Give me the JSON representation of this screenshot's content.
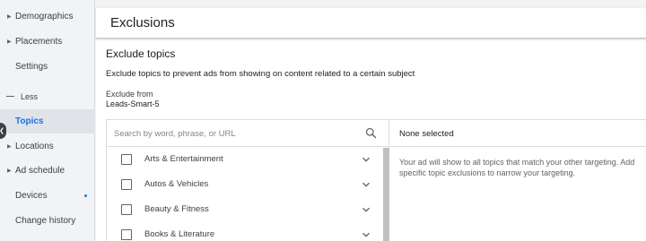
{
  "sidebar": {
    "items": [
      {
        "label": "Demographics",
        "caret": true
      },
      {
        "label": "Placements",
        "caret": true
      },
      {
        "label": "Settings",
        "caret": false
      }
    ],
    "less_label": "Less",
    "items_after": [
      {
        "label": "Topics",
        "caret": false,
        "active": true
      },
      {
        "label": "Locations",
        "caret": true
      },
      {
        "label": "Ad schedule",
        "caret": true
      },
      {
        "label": "Devices",
        "caret": false,
        "dot": true
      },
      {
        "label": "Change history",
        "caret": false
      }
    ]
  },
  "header": {
    "title": "Exclusions"
  },
  "main": {
    "section_title": "Exclude topics",
    "description": "Exclude topics to prevent ads from showing on content related to a certain subject",
    "exclude_from_label": "Exclude from",
    "exclude_from_value": "Leads-Smart-5"
  },
  "picker": {
    "search_placeholder": "Search by word, phrase, or URL",
    "topics": [
      {
        "label": "Arts & Entertainment",
        "checked": false
      },
      {
        "label": "Autos & Vehicles",
        "checked": false
      },
      {
        "label": "Beauty & Fitness",
        "checked": false
      },
      {
        "label": "Books & Literature",
        "checked": false
      }
    ],
    "selected_label": "None selected",
    "info_text": "Your ad will show to all topics that match your other targeting. Add specific topic exclusions to narrow your targeting."
  },
  "colors": {
    "accent": "#1a73e8",
    "sidebar_bg": "#f1f3f4",
    "active_bg": "#e0e3e7"
  }
}
